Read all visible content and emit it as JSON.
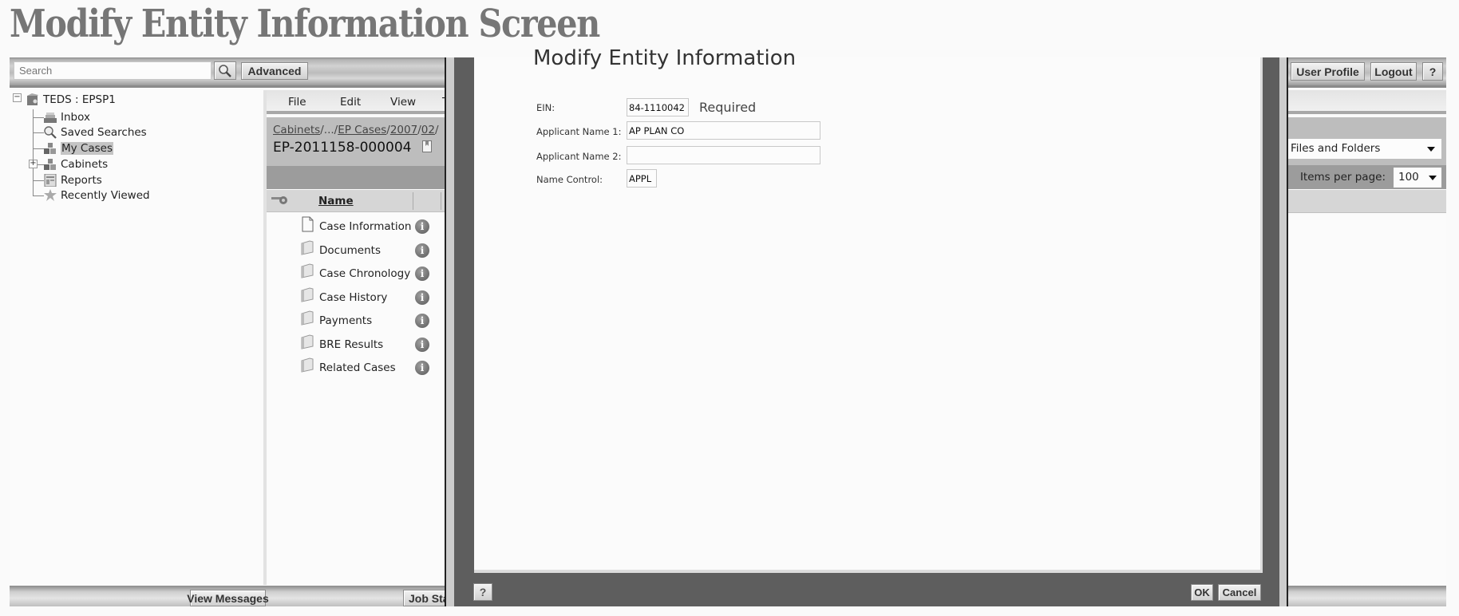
{
  "slide_title": "Modify Entity Information Screen",
  "toolbar": {
    "search_placeholder": "Search",
    "search_icon": "magnifier-icon",
    "advanced_label": "Advanced",
    "user_profile_label": "User Profile",
    "logout_label": "Logout",
    "help_label": "?"
  },
  "tree": {
    "root": "TEDS : EPSP1",
    "items": [
      {
        "label": "Inbox",
        "icon": "inbox-icon"
      },
      {
        "label": "Saved Searches",
        "icon": "saved-search-icon"
      },
      {
        "label": "My Cases",
        "icon": "cases-icon",
        "selected": true
      },
      {
        "label": "Cabinets",
        "icon": "cabinets-icon",
        "expandable": true
      },
      {
        "label": "Reports",
        "icon": "reports-icon"
      },
      {
        "label": "Recently Viewed",
        "icon": "recent-icon"
      }
    ]
  },
  "content": {
    "menu": [
      "File",
      "Edit",
      "View",
      "T"
    ],
    "breadcrumb": [
      "Cabinets",
      "...",
      "EP Cases",
      "2007",
      "02"
    ],
    "case_id": "EP-2011158-000004",
    "column_name": "Name",
    "list": [
      {
        "label": "Case Information",
        "type": "document"
      },
      {
        "label": "Documents",
        "type": "folder"
      },
      {
        "label": "Case Chronology",
        "type": "folder"
      },
      {
        "label": "Case History",
        "type": "folder"
      },
      {
        "label": "Payments",
        "type": "folder"
      },
      {
        "label": "BRE Results",
        "type": "folder"
      },
      {
        "label": "Related Cases",
        "type": "folder"
      }
    ],
    "filter_select": "Files and Folders",
    "items_per_page_label": "Items per page:",
    "items_per_page_value": "100"
  },
  "bottom_bar": {
    "view_messages": "View Messages",
    "job_status": "Job Sta"
  },
  "modal": {
    "title": "Modify Entity Information",
    "fields": {
      "ein": {
        "label": "EIN:",
        "value": "84-1110042",
        "note": "Required"
      },
      "applicant_name_1": {
        "label": "Applicant Name 1:",
        "value": "AP PLAN CO"
      },
      "applicant_name_2": {
        "label": "Applicant Name 2:",
        "value": ""
      },
      "name_control": {
        "label": "Name Control:",
        "value": "APPL"
      }
    },
    "help_label": "?",
    "ok_label": "OK",
    "cancel_label": "Cancel"
  }
}
